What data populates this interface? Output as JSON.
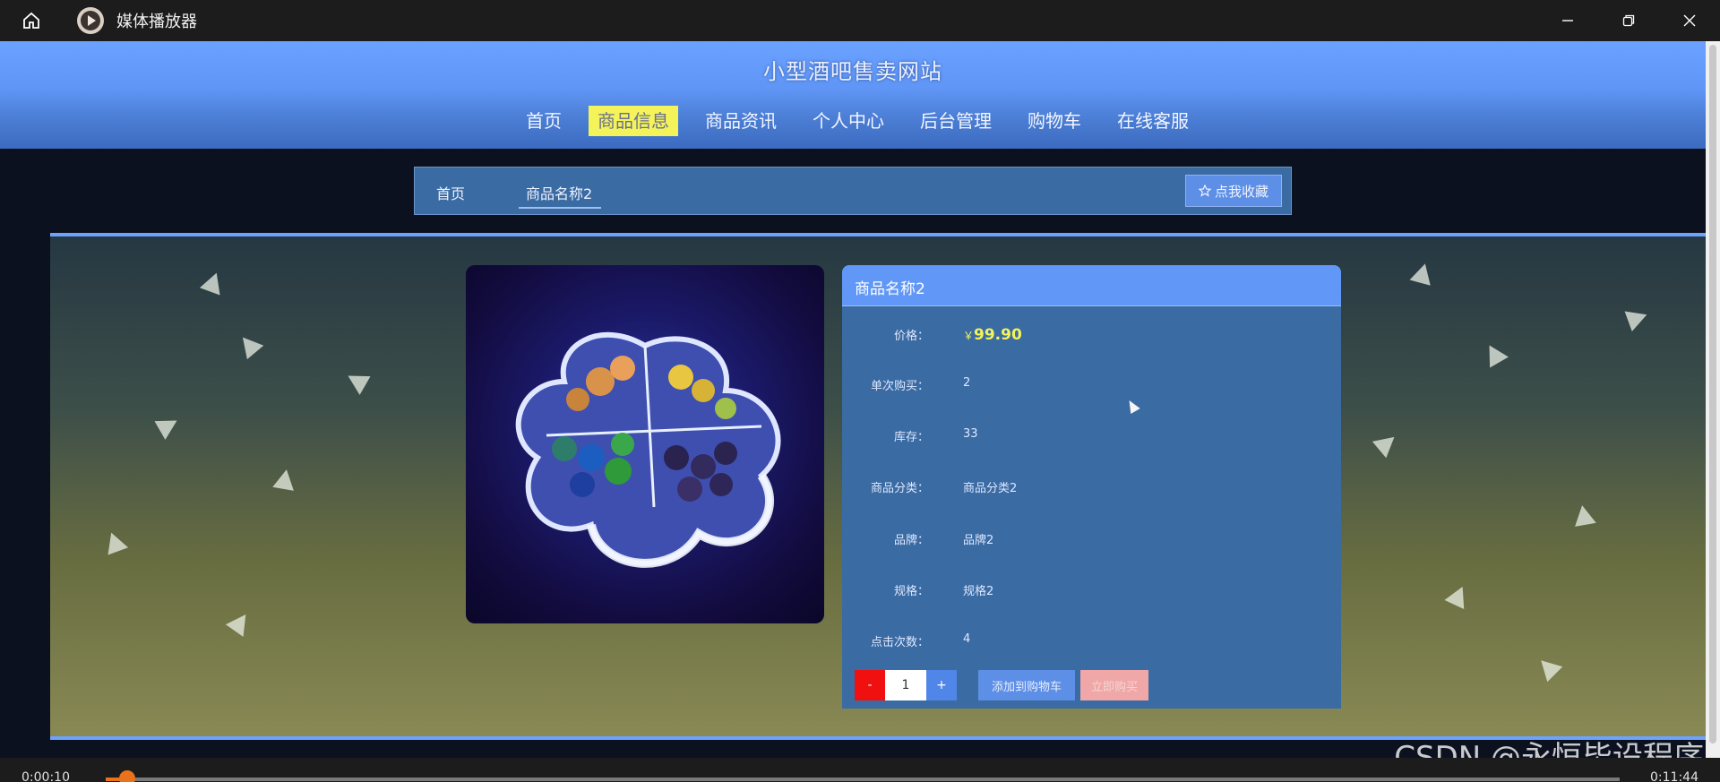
{
  "window": {
    "title": "媒体播放器",
    "home_icon": "home-icon",
    "app_icon": "play-icon",
    "controls": [
      "minimize-icon",
      "restore-icon",
      "close-icon"
    ]
  },
  "site": {
    "title": "小型酒吧售卖网站",
    "nav": [
      {
        "label": "首页",
        "active": false
      },
      {
        "label": "商品信息",
        "active": true
      },
      {
        "label": "商品资讯",
        "active": false
      },
      {
        "label": "个人中心",
        "active": false
      },
      {
        "label": "后台管理",
        "active": false
      },
      {
        "label": "购物车",
        "active": false
      },
      {
        "label": "在线客服",
        "active": false
      }
    ],
    "accent": "#6197f6",
    "active_nav_color": "#f4f35a"
  },
  "breadcrumb": {
    "home": "首页",
    "current": "商品名称2",
    "fav_button": "点我收藏"
  },
  "product": {
    "name": "商品名称2",
    "price_symbol": "￥",
    "price": "99.90",
    "fields": [
      {
        "label": "单次购买：",
        "value": "2"
      },
      {
        "label": "库存：",
        "value": "33"
      },
      {
        "label": "商品分类：",
        "value": "商品分类2"
      },
      {
        "label": "品牌：",
        "value": "品牌2"
      },
      {
        "label": "规格：",
        "value": "规格2"
      },
      {
        "label": "点击次数：",
        "value": "4"
      }
    ],
    "price_label": "价格：",
    "quantity": "1",
    "minus_label": "-",
    "plus_label": "+",
    "add_to_cart": "添加到购物车",
    "buy_now": "立即购买"
  },
  "player": {
    "current_time": "0:00:10",
    "total_time": "0:11:44",
    "progress": 0.014,
    "seek_color": "#e8731c"
  },
  "watermark": "CSDN @永恒毕设程序"
}
